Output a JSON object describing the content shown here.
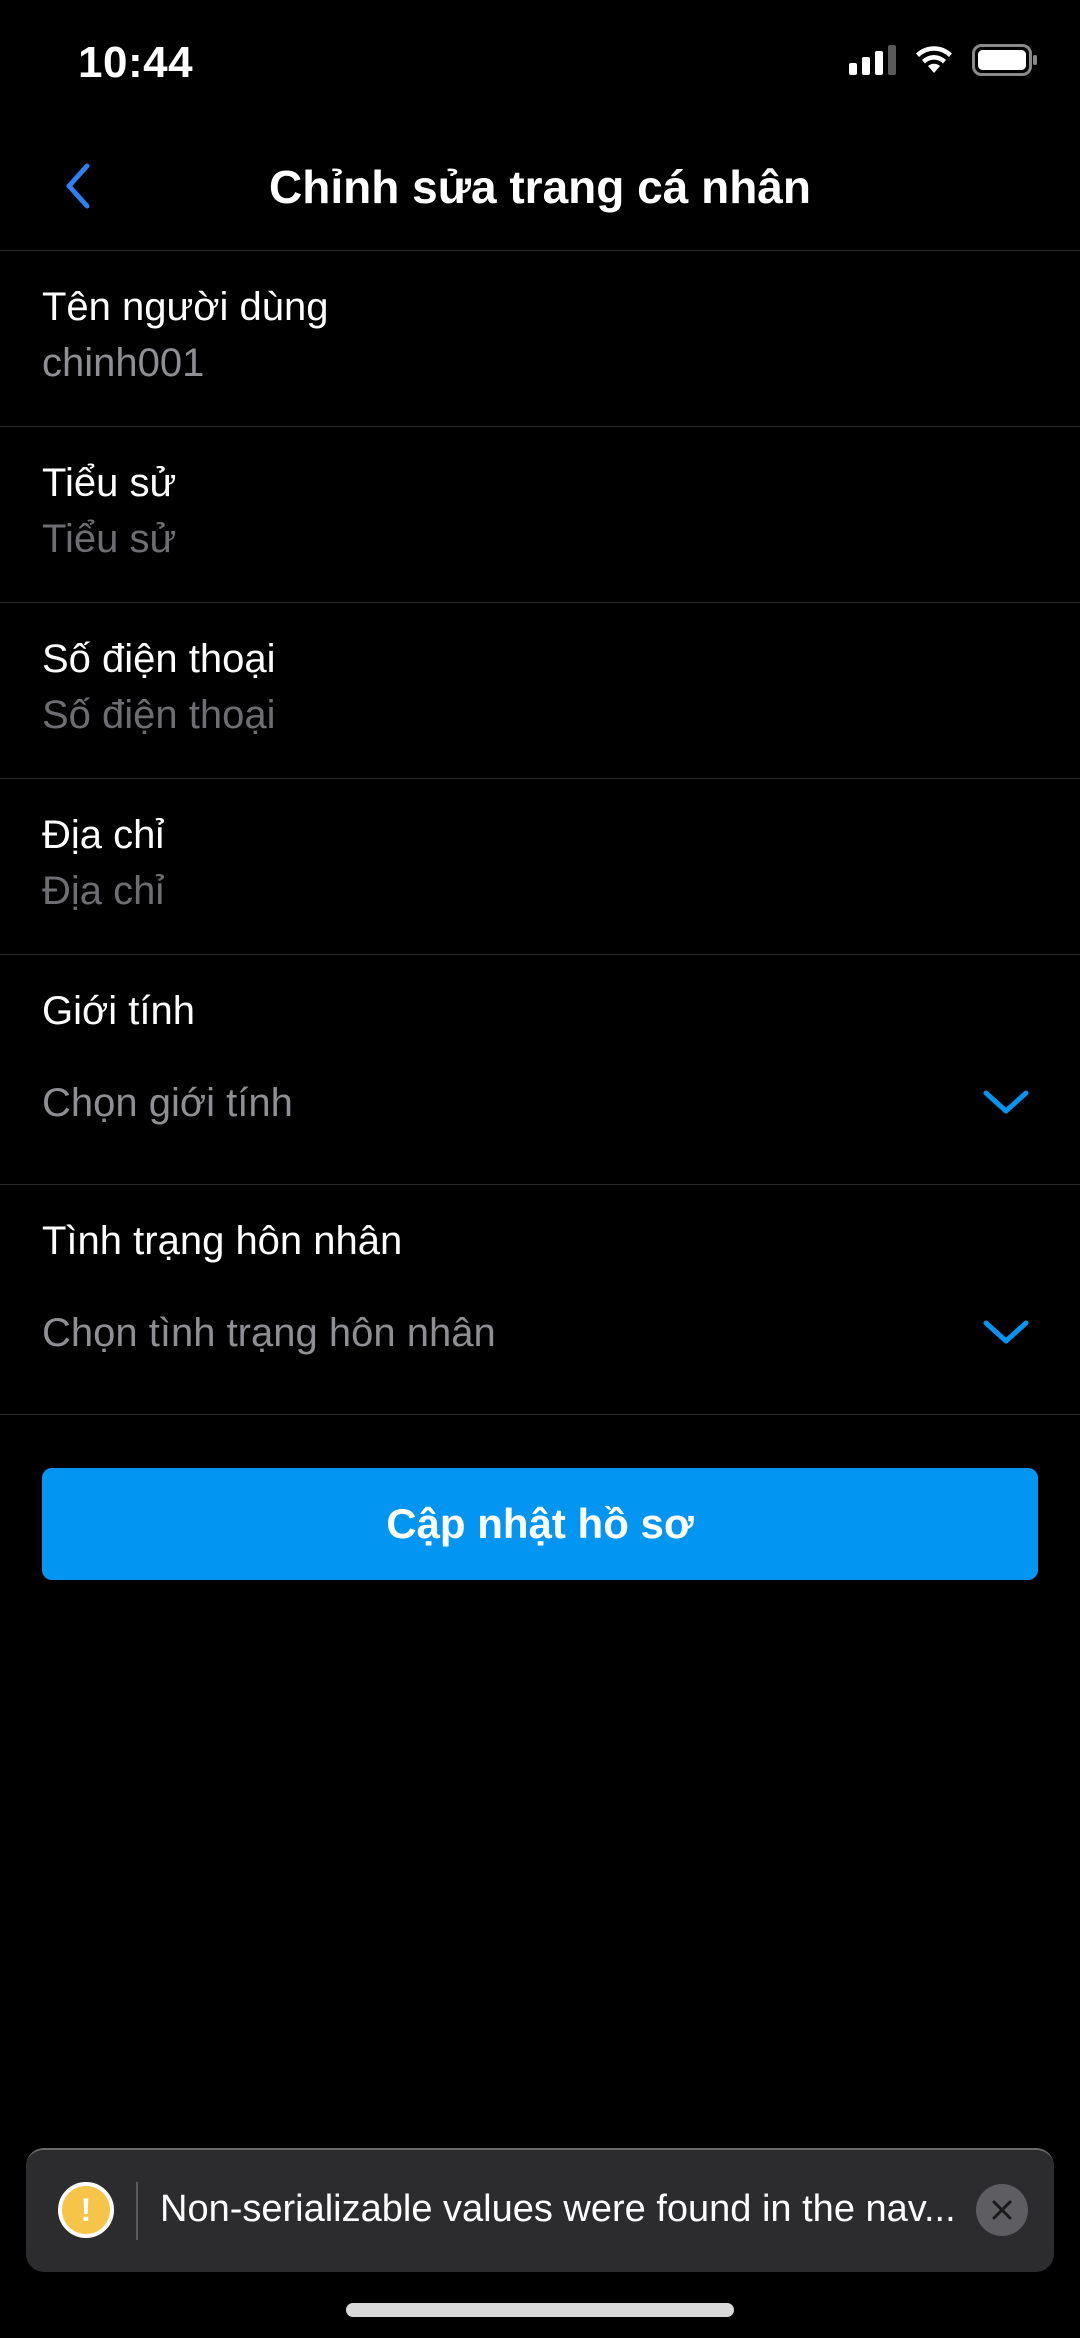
{
  "status_bar": {
    "time": "10:44",
    "icons": [
      "signal-icon",
      "wifi-icon",
      "battery-icon"
    ]
  },
  "header": {
    "title": "Chỉnh sửa trang cá nhân",
    "back_icon": "chevron-left-icon"
  },
  "form": {
    "username": {
      "label": "Tên người dùng",
      "value": "chinh001",
      "placeholder": "Tên người dùng"
    },
    "bio": {
      "label": "Tiểu sử",
      "value": "",
      "placeholder": "Tiểu sử"
    },
    "phone": {
      "label": "Số điện thoại",
      "value": "",
      "placeholder": "Số điện thoại"
    },
    "address": {
      "label": "Địa chỉ",
      "value": "",
      "placeholder": "Địa chỉ"
    },
    "gender": {
      "label": "Giới tính",
      "placeholder": "Chọn giới tính",
      "icon": "chevron-down-icon"
    },
    "marital_status": {
      "label": "Tình trạng hôn nhân",
      "placeholder": "Chọn tình trạng hôn nhân",
      "icon": "chevron-down-icon"
    }
  },
  "actions": {
    "update_label": "Cập nhật hồ sơ"
  },
  "toast": {
    "message": "Non-serializable values were found in the nav...",
    "icon": "warning-icon",
    "close_icon": "close-icon"
  },
  "colors": {
    "background": "#000000",
    "accent": "#0395f2",
    "back_chevron": "#2f7ff5",
    "placeholder": "#8e8e93",
    "divider": "#2b2b2b",
    "toast_background": "#2c2c2e",
    "warning": "#f7c44a"
  }
}
